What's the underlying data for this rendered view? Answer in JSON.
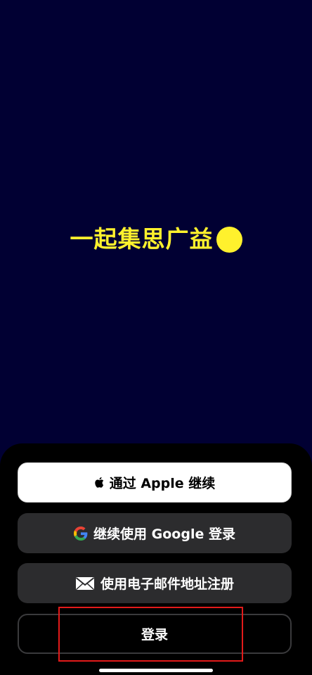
{
  "hero": {
    "headline": "一起集思广益"
  },
  "auth": {
    "apple_label": "通过 Apple 继续",
    "google_label": "继续使用 Google 登录",
    "email_label": "使用电子邮件地址注册",
    "login_label": "登录"
  },
  "icons": {
    "apple": "apple-logo-icon",
    "google": "google-logo-icon",
    "email": "envelope-icon"
  },
  "colors": {
    "background": "#010033",
    "accent": "#FFF12D",
    "button_dark": "#2C2C2E",
    "highlight": "#E21A1A"
  }
}
